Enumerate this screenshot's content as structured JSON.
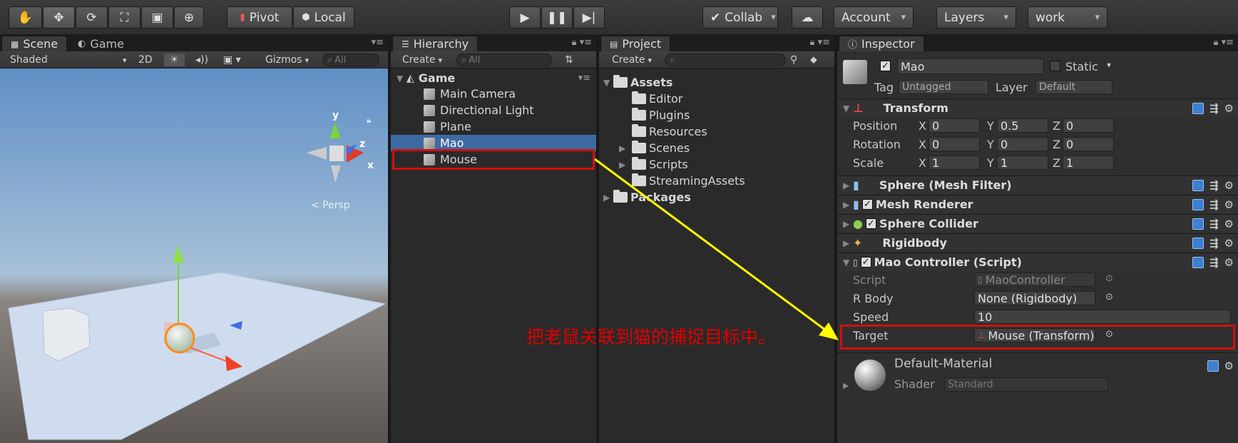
{
  "toolbar": {
    "pivot": "Pivot",
    "local": "Local",
    "collab": "Collab",
    "account": "Account",
    "layers": "Layers",
    "layout": "work"
  },
  "scene": {
    "tab_scene": "Scene",
    "tab_game": "Game",
    "shaded": "Shaded",
    "mode2d": "2D",
    "gizmos": "Gizmos",
    "search": "All",
    "persp": "< Persp",
    "axis_y": "y",
    "axis_z": "z",
    "axis_x": "x"
  },
  "hierarchy": {
    "tab": "Hierarchy",
    "create": "Create",
    "search": "All",
    "root": "Game",
    "items": [
      "Main Camera",
      "Directional Light",
      "Plane",
      "Mao",
      "Mouse"
    ]
  },
  "project": {
    "tab": "Project",
    "create": "Create",
    "assets": "Assets",
    "folders": [
      "Editor",
      "Plugins",
      "Resources",
      "Scenes",
      "Scripts",
      "StreamingAssets"
    ],
    "packages": "Packages"
  },
  "inspector": {
    "tab": "Inspector",
    "name": "Mao",
    "static": "Static",
    "tag_label": "Tag",
    "tag_value": "Untagged",
    "layer_label": "Layer",
    "layer_value": "Default",
    "transform": "Transform",
    "position": "Position",
    "rotation": "Rotation",
    "scale": "Scale",
    "pos": {
      "x": "0",
      "y": "0.5",
      "z": "0"
    },
    "rot": {
      "x": "0",
      "y": "0",
      "z": "0"
    },
    "scl": {
      "x": "1",
      "y": "1",
      "z": "1"
    },
    "X": "X",
    "Y": "Y",
    "Z": "Z",
    "mesh_filter": "Sphere (Mesh Filter)",
    "mesh_renderer": "Mesh Renderer",
    "sphere_collider": "Sphere Collider",
    "rigidbody": "Rigidbody",
    "script_comp": "Mao Controller (Script)",
    "script_label": "Script",
    "script_value": "MaoController",
    "rbody_label": "R Body",
    "rbody_value": "None (Rigidbody)",
    "speed_label": "Speed",
    "speed_value": "10",
    "target_label": "Target",
    "target_value": "Mouse (Transform)",
    "material": "Default-Material",
    "shader_label": "Shader",
    "shader_value": "Standard"
  },
  "annotation": {
    "text": "把老鼠关联到猫的捕捉目标中。",
    "color": "#e00000",
    "arrow_color": "#ffff00",
    "box_color": "#d01010"
  }
}
